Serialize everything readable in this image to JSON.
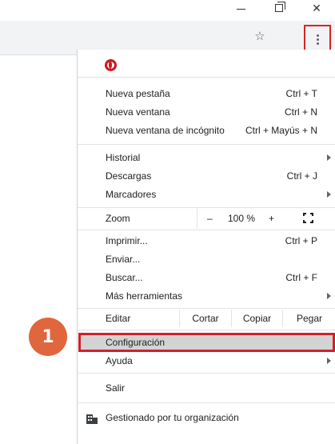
{
  "window": {
    "minimize_glyph": "minimize-icon",
    "maximize_glyph": "restore-icon",
    "close_glyph": "close-icon",
    "close_label": "✕"
  },
  "toolbar": {
    "bookmark_icon": "star-icon",
    "bookmark_label": "☆",
    "menu_icon": "three-dots-vertical-icon",
    "highlight_color": "#d32626"
  },
  "menu": {
    "logo_icon": "opera-logo-icon",
    "group1": [
      {
        "label": "Nueva pestaña",
        "shortcut": "Ctrl + T"
      },
      {
        "label": "Nueva ventana",
        "shortcut": "Ctrl + N"
      },
      {
        "label": "Nueva ventana de incógnito",
        "shortcut": "Ctrl + Mayús + N"
      }
    ],
    "group2": [
      {
        "label": "Historial",
        "shortcut": ""
      },
      {
        "label": "Descargas",
        "shortcut": "Ctrl + J"
      },
      {
        "label": "Marcadores",
        "shortcut": ""
      }
    ],
    "zoom": {
      "label": "Zoom",
      "minus": "–",
      "value": "100 %",
      "plus": "+",
      "fullscreen_icon": "fullscreen-icon"
    },
    "group3": [
      {
        "label": "Imprimir...",
        "shortcut": "Ctrl + P"
      },
      {
        "label": "Enviar...",
        "shortcut": ""
      },
      {
        "label": "Buscar...",
        "shortcut": "Ctrl + F"
      },
      {
        "label": "Más herramientas",
        "shortcut": ""
      }
    ],
    "edit": {
      "label": "Editar",
      "cut": "Cortar",
      "copy": "Copiar",
      "paste": "Pegar"
    },
    "settings": {
      "label": "Configuración",
      "highlight_color": "#d0202a"
    },
    "help": {
      "label": "Ayuda"
    },
    "exit": {
      "label": "Salir"
    },
    "managed": {
      "label": "Gestionado por tu organización",
      "icon": "building-icon"
    }
  },
  "annotation": {
    "step": "1",
    "color": "#e0663d"
  }
}
